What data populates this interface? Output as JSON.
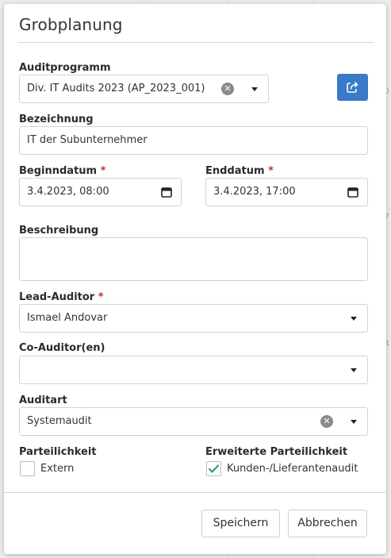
{
  "background": {
    "side_hints": [
      "0",
      "7",
      "24"
    ]
  },
  "dialog": {
    "title": "Grobplanung",
    "auditprogramm": {
      "label": "Auditprogramm",
      "value": "Div. IT Audits 2023 (AP_2023_001)"
    },
    "bezeichnung": {
      "label": "Bezeichnung",
      "value": "IT der Subunternehmer"
    },
    "beginndatum": {
      "label": "Beginndatum",
      "required_mark": "*",
      "value": "3.4.2023, 08:00"
    },
    "enddatum": {
      "label": "Enddatum",
      "required_mark": "*",
      "value": "3.4.2023, 17:00"
    },
    "beschreibung": {
      "label": "Beschreibung",
      "value": ""
    },
    "lead_auditor": {
      "label": "Lead-Auditor",
      "required_mark": "*",
      "value": "Ismael Andovar"
    },
    "co_auditor": {
      "label": "Co-Auditor(en)",
      "value": ""
    },
    "auditart": {
      "label": "Auditart",
      "value": "Systemaudit"
    },
    "parteilichkeit": {
      "label": "Parteilichkeit",
      "option_label": "Extern",
      "checked": false
    },
    "erweiterte_parteilichkeit": {
      "label": "Erweiterte Parteilichkeit",
      "option_label": "Kunden-/Lieferantenaudit",
      "checked": true
    },
    "buttons": {
      "save": "Speichern",
      "cancel": "Abbrechen"
    }
  },
  "colors": {
    "primary": "#3a7ac8",
    "required": "#c9302c",
    "check": "#2e9e6e"
  }
}
